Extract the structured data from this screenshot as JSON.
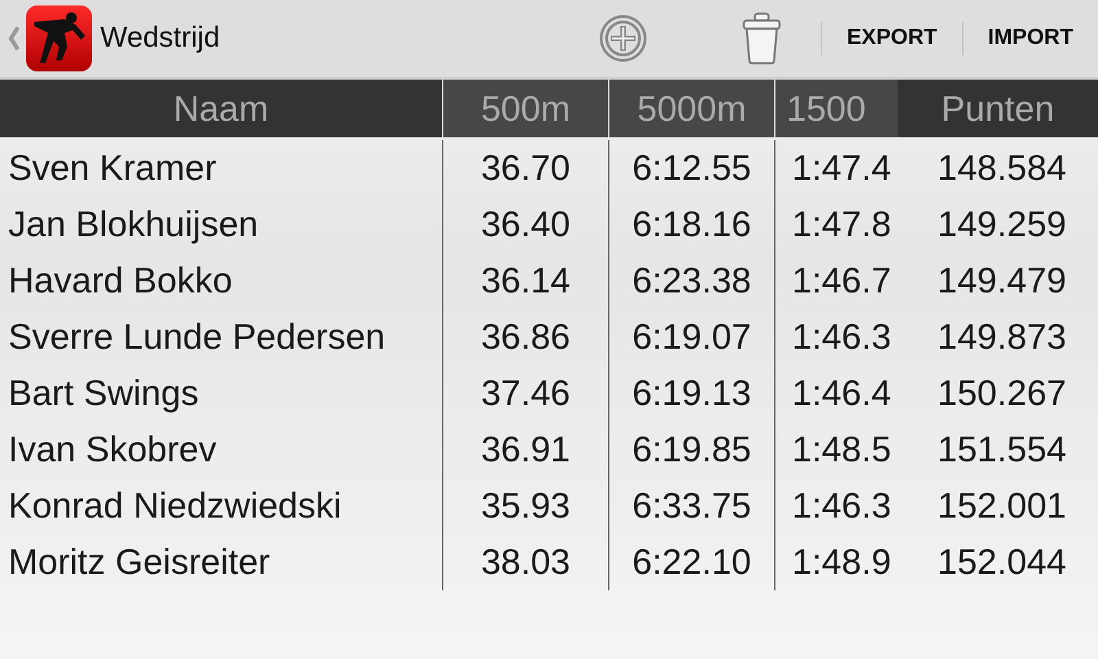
{
  "action_bar": {
    "title": "Wedstrijd",
    "actions": [
      {
        "kind": "add"
      },
      {
        "kind": "delete"
      },
      {
        "kind": "text",
        "label": "EXPORT"
      },
      {
        "kind": "text",
        "label": "IMPORT"
      }
    ]
  },
  "table": {
    "columns": [
      {
        "label": "Naam",
        "shaded": false,
        "kind": "name"
      },
      {
        "label": "500m",
        "shaded": true,
        "kind": "time"
      },
      {
        "label": "5000m",
        "shaded": true,
        "kind": "time"
      },
      {
        "label": "1500",
        "shaded": true,
        "kind": "cut"
      },
      {
        "label": "Punten",
        "shaded": false,
        "kind": "points"
      }
    ],
    "rows": [
      [
        "Sven Kramer",
        "36.70",
        "6:12.55",
        "1:47.4",
        "148.584"
      ],
      [
        "Jan Blokhuijsen",
        "36.40",
        "6:18.16",
        "1:47.8",
        "149.259"
      ],
      [
        "Havard Bokko",
        "36.14",
        "6:23.38",
        "1:46.7",
        "149.479"
      ],
      [
        "Sverre Lunde Pedersen",
        "36.86",
        "6:19.07",
        "1:46.3",
        "149.873"
      ],
      [
        "Bart Swings",
        "37.46",
        "6:19.13",
        "1:46.4",
        "150.267"
      ],
      [
        "Ivan Skobrev",
        "36.91",
        "6:19.85",
        "1:48.5",
        "151.554"
      ],
      [
        "Konrad Niedzwiedski",
        "35.93",
        "6:33.75",
        "1:46.3",
        "152.001"
      ],
      [
        "Moritz Geisreiter",
        "38.03",
        "6:22.10",
        "1:48.9",
        "152.044"
      ]
    ]
  }
}
